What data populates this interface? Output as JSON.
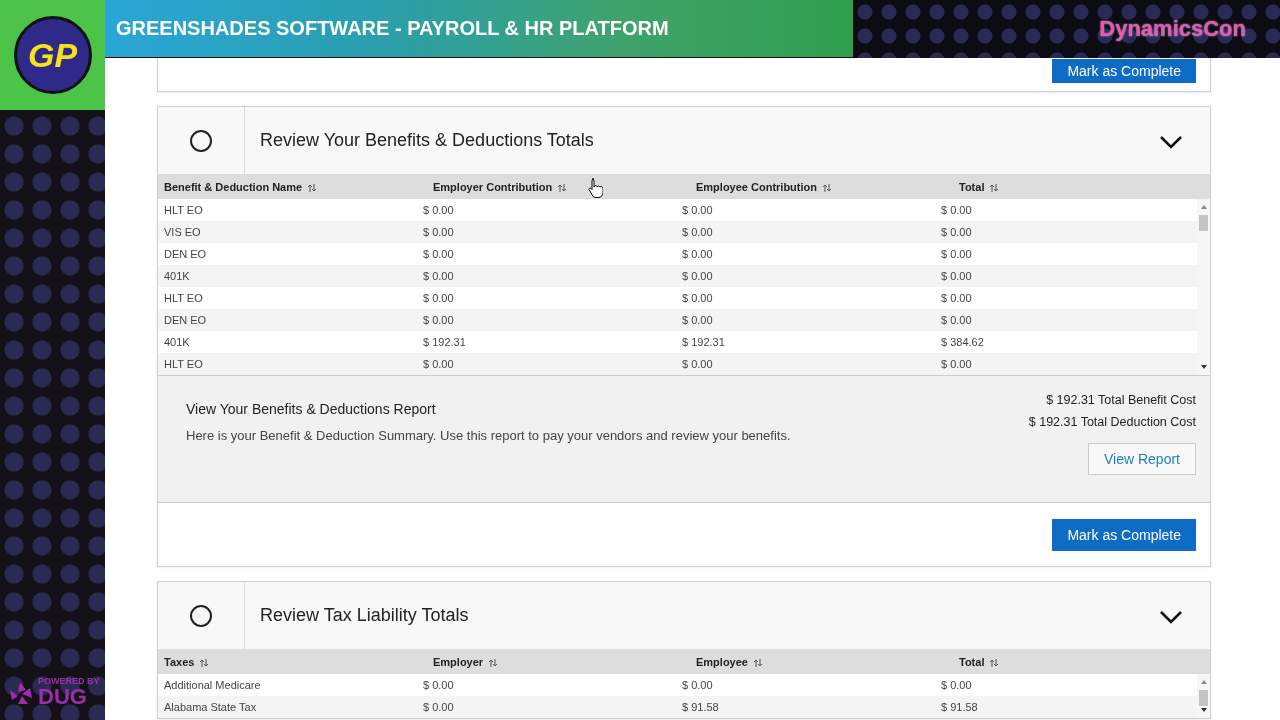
{
  "overlay": {
    "logo": "GP",
    "banner_title": "GREENSHADES SOFTWARE - PAYROLL & HR PLATFORM",
    "event_logo": "DynamicsCon",
    "footer_logo_caption": "POWERED BY",
    "footer_logo": "DUG"
  },
  "sections": [
    {
      "kind": "footer_only",
      "button": "Mark as Complete"
    },
    {
      "kind": "step",
      "title": "Review Your Benefits & Deductions Totals",
      "completed": false,
      "expanded": true,
      "table": {
        "columns": [
          "Benefit & Deduction Name",
          "Employer Contribution",
          "Employee Contribution",
          "Total"
        ],
        "rows": [
          [
            "HLT EO",
            "$ 0.00",
            "$ 0.00",
            "$ 0.00"
          ],
          [
            "VIS EO",
            "$ 0.00",
            "$ 0.00",
            "$ 0.00"
          ],
          [
            "DEN EO",
            "$ 0.00",
            "$ 0.00",
            "$ 0.00"
          ],
          [
            "401K",
            "$ 0.00",
            "$ 0.00",
            "$ 0.00"
          ],
          [
            "HLT EO",
            "$ 0.00",
            "$ 0.00",
            "$ 0.00"
          ],
          [
            "DEN EO",
            "$ 0.00",
            "$ 0.00",
            "$ 0.00"
          ],
          [
            "401K",
            "$ 192.31",
            "$ 192.31",
            "$ 384.62"
          ],
          [
            "HLT EO",
            "$ 0.00",
            "$ 0.00",
            "$ 0.00"
          ]
        ]
      },
      "summary": {
        "title": "View Your Benefits & Deductions Report",
        "text": "Here is your Benefit & Deduction Summary. Use this report to pay your vendors and review your benefits.",
        "totals": [
          "$ 192.31 Total Benefit Cost",
          "$ 192.31 Total Deduction Cost"
        ],
        "link_button": "View Report"
      },
      "button": "Mark as Complete"
    },
    {
      "kind": "step",
      "title": "Review Tax Liability Totals",
      "completed": false,
      "expanded": true,
      "table": {
        "columns": [
          "Taxes",
          "Employer",
          "Employee",
          "Total"
        ],
        "rows": [
          [
            "Additional Medicare",
            "$ 0.00",
            "$ 0.00",
            "$ 0.00"
          ],
          [
            "Alabama State Tax",
            "$ 0.00",
            "$ 91.58",
            "$ 91.58"
          ]
        ]
      }
    }
  ]
}
